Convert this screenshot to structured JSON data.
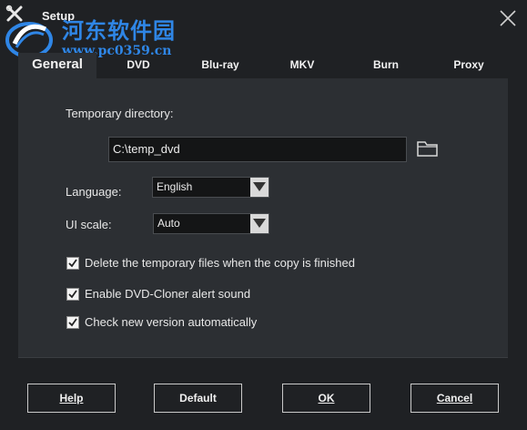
{
  "window": {
    "title": "Setup"
  },
  "watermark": {
    "text_cn": "河东软件园",
    "url": "www.pc0359.cn"
  },
  "tabs": [
    {
      "label": "General",
      "active": true
    },
    {
      "label": "DVD",
      "active": false
    },
    {
      "label": "Blu-ray",
      "active": false
    },
    {
      "label": "MKV",
      "active": false
    },
    {
      "label": "Burn",
      "active": false
    },
    {
      "label": "Proxy",
      "active": false
    }
  ],
  "general": {
    "temp_dir_label": "Temporary directory:",
    "temp_dir_value": "C:\\temp_dvd",
    "language_label": "Language:",
    "language_value": "English",
    "ui_scale_label": "UI scale:",
    "ui_scale_value": "Auto",
    "options": [
      {
        "label": "Delete the temporary files when the copy is finished",
        "checked": true
      },
      {
        "label": "Enable DVD-Cloner alert sound",
        "checked": true
      },
      {
        "label": "Check new version automatically",
        "checked": true
      }
    ]
  },
  "buttons": {
    "help": "Help",
    "default": "Default",
    "ok": "OK",
    "cancel": "Cancel"
  },
  "icons": {
    "app": "tools-icon",
    "close": "close-icon",
    "folder": "folder-icon",
    "dropdown": "triangle-down-icon",
    "check": "checkmark-icon"
  },
  "colors": {
    "window_bg": "#1f2124",
    "panel_bg": "#2c2f33",
    "input_bg": "#141516",
    "watermark_blue": "#2f86e6"
  }
}
